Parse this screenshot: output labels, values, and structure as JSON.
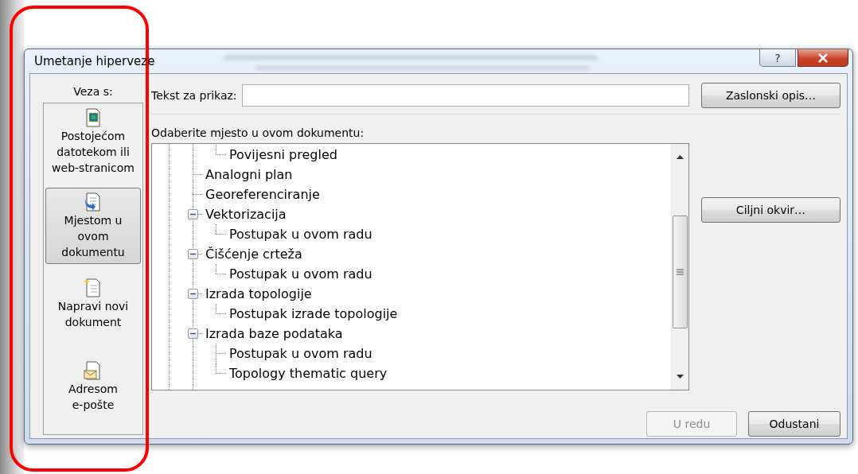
{
  "window": {
    "title": "Umetanje hiperveze",
    "help_button": "?"
  },
  "link_to": {
    "label": "Veza s:",
    "options": [
      {
        "kind": "file",
        "label": "Postojećom datotekom ili web-stranicom",
        "selected": false
      },
      {
        "kind": "place",
        "label": "Mjestom u ovom dokumentu",
        "selected": true
      },
      {
        "kind": "new",
        "label": "Napravi novi dokument",
        "selected": false
      },
      {
        "kind": "email",
        "label": "Adresom e-pošte",
        "selected": false
      }
    ]
  },
  "text_to_display": {
    "label": "Tekst za prikaz:"
  },
  "screen_tip_button": "Zaslonski opis…",
  "place": {
    "label": "Odaberite mjesto u ovom dokumentu:",
    "tree": {
      "continued_branch": [
        {
          "label": "Povijesni pregled"
        }
      ],
      "items": [
        {
          "label": "Analogni plan"
        },
        {
          "label": "Georeferenciranje"
        },
        {
          "label": "Vektorizacija",
          "expanded": true,
          "children": [
            {
              "label": "Postupak u ovom radu"
            }
          ]
        },
        {
          "label": "Čišćenje crteža",
          "expanded": true,
          "children": [
            {
              "label": "Postupak u ovom radu"
            }
          ]
        },
        {
          "label": "Izrada topologije",
          "expanded": true,
          "children": [
            {
              "label": "Postupak izrade topologije"
            }
          ]
        },
        {
          "label": "Izrada baze podataka",
          "expanded": true,
          "children": [
            {
              "label": "Postupak u ovom radu"
            },
            {
              "label": "Topology thematic query"
            }
          ]
        }
      ]
    }
  },
  "target_frame_button": "Ciljni okvir…",
  "buttons": [
    {
      "label": "U redu",
      "disabled": true
    },
    {
      "label": "Odustani",
      "disabled": false
    }
  ]
}
